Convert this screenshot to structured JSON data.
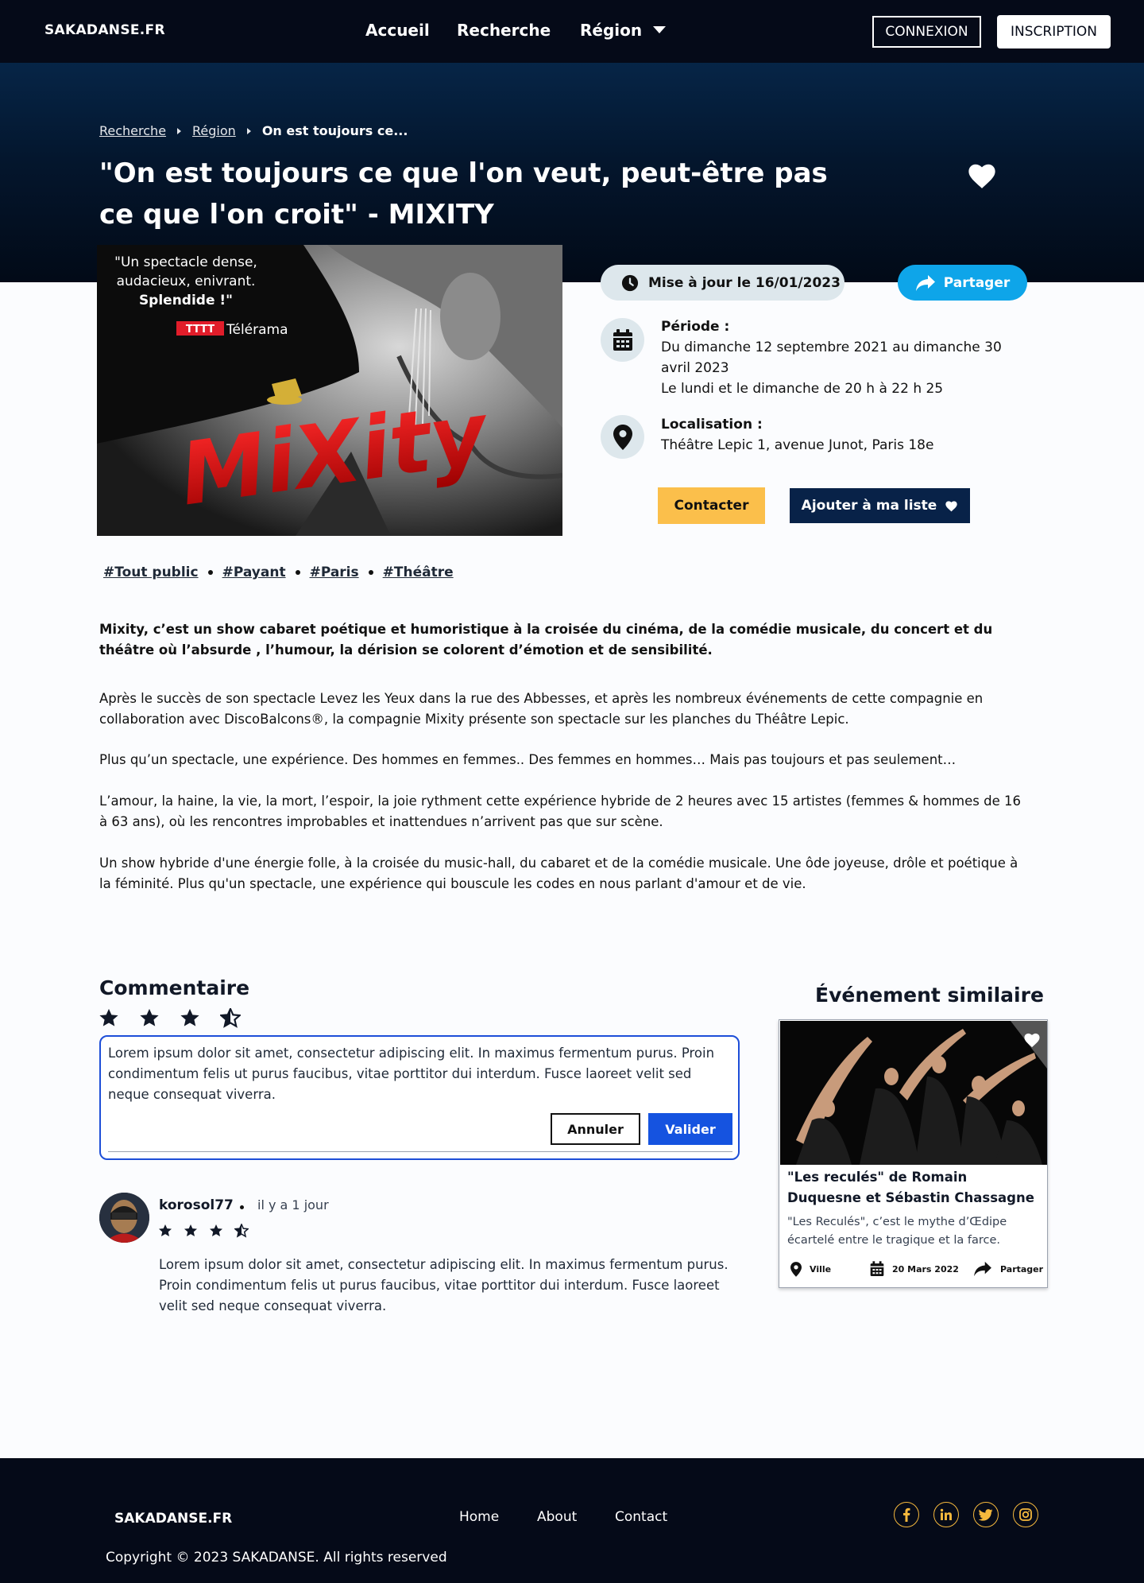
{
  "brand": "SAKADANSE.FR",
  "nav": {
    "home": "Accueil",
    "search": "Recherche",
    "region": "Région",
    "login": "CONNEXION",
    "signup": "INSCRIPTION"
  },
  "breadcrumb": {
    "items": [
      "Recherche",
      "Région"
    ],
    "current": "On est toujours ce..."
  },
  "event": {
    "title": "\"On est toujours ce que l'on veut, peut-être pas ce que l'on croit\" - MIXITY",
    "poster": {
      "quote_line1": "\"Un spectacle dense,",
      "quote_line2": "audacieux, enivrant.",
      "quote_line3": "Splendide !\"",
      "rating": "TTTT",
      "press": "Télérama",
      "logo": "MiXity"
    },
    "updated": "Mise à jour le 16/01/2023",
    "share": "Partager",
    "period_label": "Période :",
    "period_line1": "Du dimanche 12 septembre 2021 au dimanche 30 avril 2023",
    "period_line2": "Le lundi et le dimanche de 20 h à 22 h 25",
    "location_label": "Localisation :",
    "location": "Théâtre Lepic 1, avenue Junot, Paris 18e",
    "contact": "Contacter",
    "add_list": "Ajouter à ma liste",
    "tags": [
      "#Tout public",
      "#Payant",
      "#Paris",
      "#Théâtre"
    ],
    "lead": "Mixity, c’est un show cabaret poétique et humoristique à la croisée du cinéma, de la comédie musicale, du concert et du théâtre où l’absurde , l’humour, la dérision se colorent d’émotion et de sensibilité.",
    "paragraphs": [
      "Après le succès de son spectacle Levez les Yeux dans la rue des Abbesses, et après les nombreux événements de cette compagnie en collaboration avec DiscoBalcons®, la compagnie Mixity présente son spectacle sur les planches du Théâtre Lepic.",
      "Plus qu’un spectacle, une expérience. Des hommes en femmes.. Des femmes en hommes… Mais pas toujours et pas seulement…",
      "L’amour, la haine, la vie, la mort, l’espoir, la joie rythment cette expérience hybride de 2 heures avec 15 artistes (femmes & hommes de 16 à 63 ans), où les rencontres improbables et inattendues n’arrivent pas que sur scène.",
      "Un show hybride d'une énergie folle, à la croisée du music-hall, du cabaret et de la comédie musicale. Une ôde joyeuse, drôle et poétique à la féminité. Plus qu'un spectacle, une expérience qui bouscule les codes en nous parlant d'amour et de vie."
    ]
  },
  "comments": {
    "title": "Commentaire",
    "input_rating": 3.5,
    "draft": "Lorem ipsum dolor sit amet, consectetur adipiscing elit. In maximus fermentum purus. Proin condimentum felis ut purus faucibus, vitae porttitor dui interdum. Fusce laoreet velit sed neque consequat viverra.",
    "cancel": "Annuler",
    "submit": "Valider",
    "reviews": [
      {
        "user": "korosol77",
        "time": "il y a 1 jour",
        "rating": 3.5,
        "text": "Lorem ipsum dolor sit amet, consectetur adipiscing elit. In maximus fermentum purus. Proin condimentum felis ut purus faucibus, vitae porttitor dui interdum. Fusce laoreet velit sed neque consequat viverra."
      }
    ]
  },
  "similar": {
    "title": "Événement similaire",
    "card": {
      "title": "\"Les reculés\" de Romain Duquesne et Sébastin Chassagne",
      "desc": "\"Les Reculés\", c’est le mythe d’Œdipe écartelé entre le tragique et la farce.",
      "city": "Ville",
      "date": "20 Mars 2022",
      "share": "Partager"
    }
  },
  "footer": {
    "brand": "SAKADANSE.FR",
    "links": [
      "Home",
      "About",
      "Contact"
    ],
    "social": [
      "facebook-icon",
      "linkedin-icon",
      "twitter-icon",
      "instagram-icon"
    ],
    "copyright": "Copyright © 2023 SAKADANSE. All rights reserved"
  },
  "colors": {
    "nav_bg": "#050a18",
    "accent_blue": "#0ea5e9",
    "primary_blue": "#1553e0",
    "navy": "#082248",
    "yellow": "#fbbf4b",
    "social_gold": "#f5b83d"
  }
}
